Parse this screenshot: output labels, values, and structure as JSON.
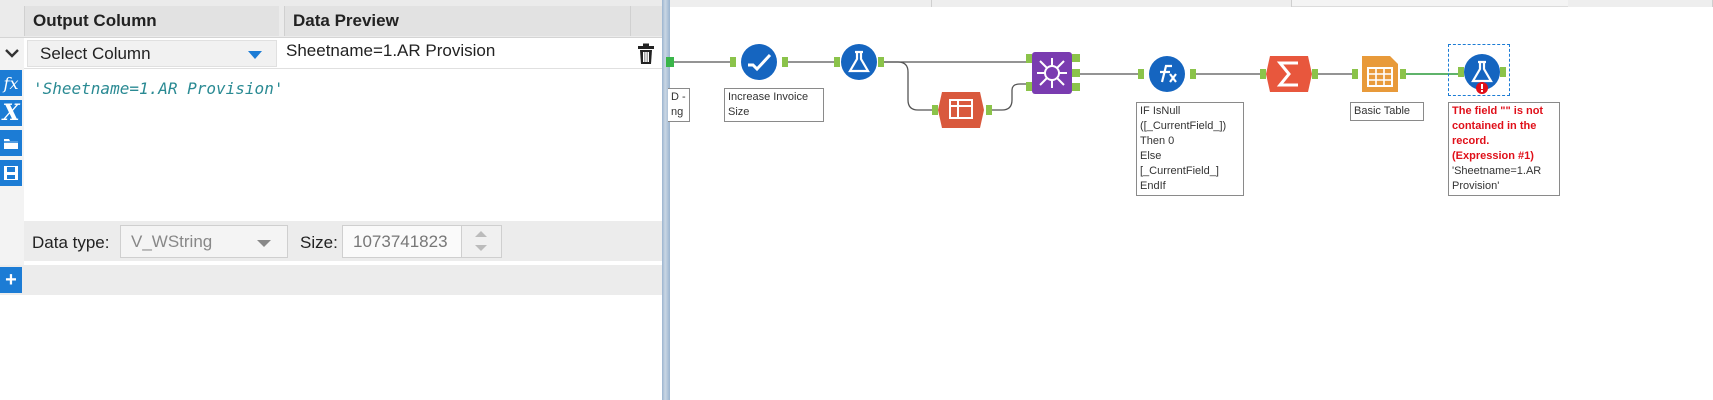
{
  "config": {
    "headers": {
      "output_column": "Output Column",
      "data_preview": "Data Preview"
    },
    "row": {
      "column_select": "Select Column",
      "preview": "Sheetname=1.AR Provision"
    },
    "expression": "'Sheetname=1.AR Provision'",
    "tool_icons": [
      "fx-icon",
      "variable-icon",
      "open-folder-icon",
      "save-icon"
    ],
    "data_type_label": "Data type:",
    "data_type_value": "V_WString",
    "size_label": "Size:",
    "size_value": "1073741823",
    "accent_color": "#1c7cd5",
    "expression_color": "#2a8a93"
  },
  "workflow": {
    "annotations": {
      "first_partial": [
        "D -",
        "ng"
      ],
      "increase_invoice": [
        "Increase Invoice",
        "Size"
      ],
      "multi_field": [
        "IF IsNull",
        "([_CurrentField_])",
        "Then 0",
        "Else",
        "[_CurrentField_]",
        "EndIf"
      ],
      "basic_table": [
        "Basic Table"
      ],
      "formula_error": [
        "The field \"\" is not",
        "contained in the",
        "record.",
        "(Expression #1)"
      ],
      "formula_expr": [
        "'Sheetname=1.AR",
        "Provision'"
      ]
    },
    "tools": [
      "input-tool-icon",
      "select-records-icon",
      "formula-tool-icon",
      "crosstab-icon",
      "join-multiple-icon",
      "multi-field-formula-icon",
      "summarize-icon",
      "basic-table-icon",
      "formula-error-tool-icon"
    ],
    "error_color": "#e0101a"
  }
}
